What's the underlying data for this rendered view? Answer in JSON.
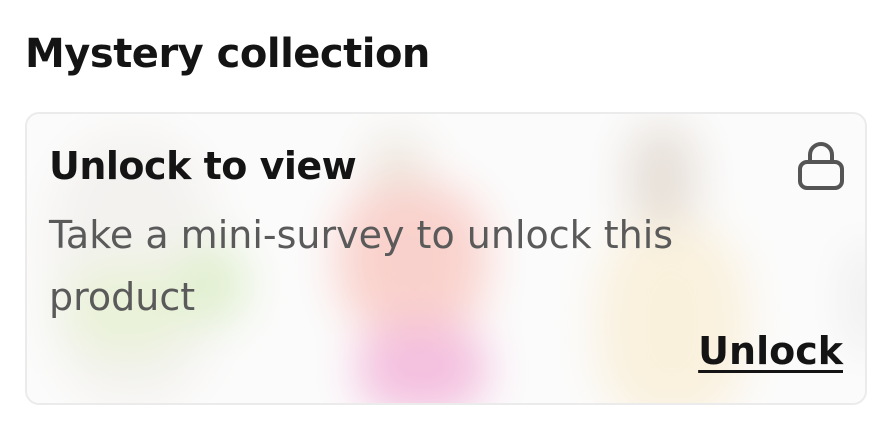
{
  "section": {
    "title": "Mystery collection"
  },
  "card": {
    "title": "Unlock to view",
    "description": "Take a mini-survey to unlock this product",
    "action_label": "Unlock",
    "lock_icon": "lock-icon"
  },
  "colors": {
    "text_primary": "#141414",
    "text_secondary": "#5a5a5a",
    "card_border": "#ebebeb"
  }
}
